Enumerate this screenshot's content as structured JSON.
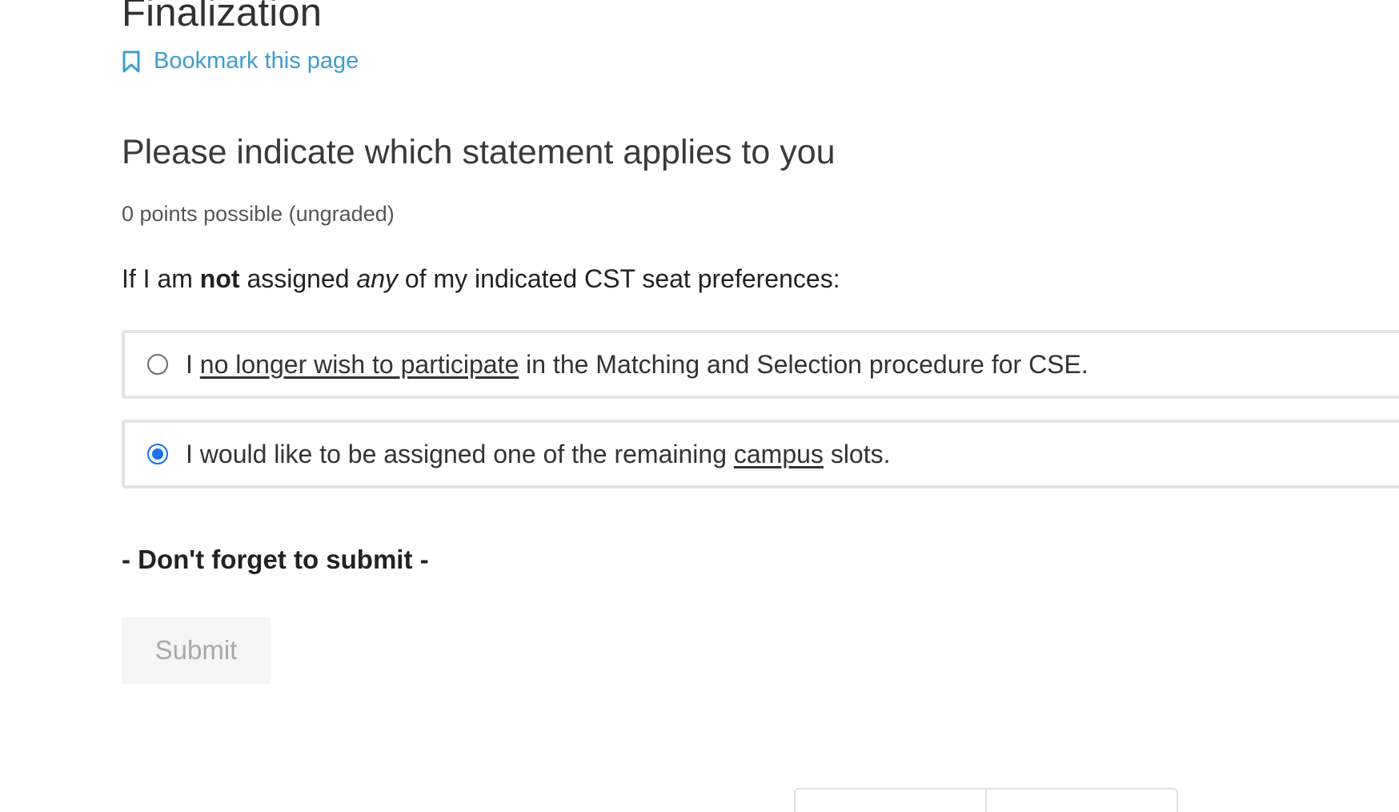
{
  "page": {
    "title": "Finalization",
    "bookmark_label": "Bookmark this page"
  },
  "problem": {
    "question": "Please indicate which statement applies to you",
    "points": "0 points possible (ungraded)",
    "prompt": {
      "part1": "If I am ",
      "bold": "not",
      "part2": " assigned ",
      "italic": "any",
      "part3": " of my indicated CST seat preferences:"
    },
    "options": [
      {
        "prefix": "I ",
        "underlined": "no longer wish to participate",
        "suffix": " in the Matching and Selection procedure for CSE.",
        "selected": false
      },
      {
        "prefix": "I would like to be assigned one of the remaining ",
        "underlined": "campus",
        "suffix": " slots.",
        "selected": true
      }
    ],
    "reminder": "- Don't forget to submit -",
    "submit_label": "Submit"
  },
  "icons": {
    "bookmark": "bookmark-icon"
  },
  "colors": {
    "link": "#3f9ccf",
    "radio_selected": "#1a73e8",
    "submit_disabled_bg": "#f5f5f5",
    "submit_disabled_text": "#a8a8a8"
  }
}
